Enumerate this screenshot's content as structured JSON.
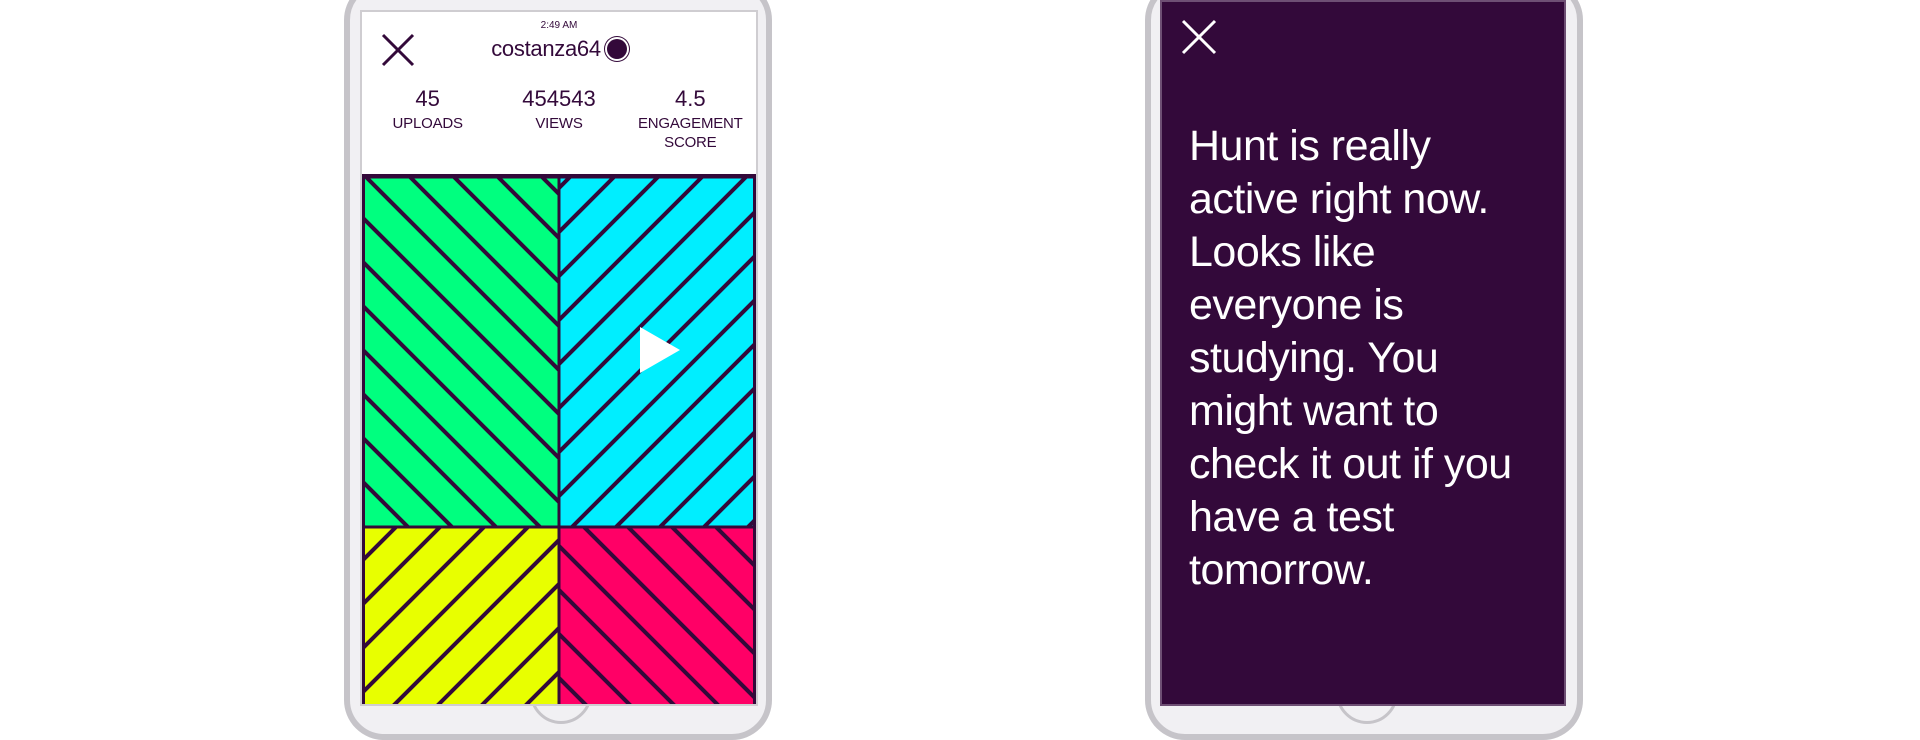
{
  "profile_screen": {
    "status_time": "2:49 AM",
    "username": "costanza64",
    "close_icon": "close-icon",
    "online_indicator_icon": "online-dot-icon",
    "stats": [
      {
        "value": "45",
        "label": "UPLOADS"
      },
      {
        "value": "454543",
        "label": "VIEWS"
      },
      {
        "value": "4.5",
        "label": "ENGAGEMENT SCORE"
      }
    ],
    "video": {
      "play_icon": "play-icon",
      "colors": {
        "top_left": "#00ff7f",
        "top_right": "#00eeff",
        "bottom_left": "#e8ff00",
        "bottom_right": "#ff0066",
        "stripe": "#33093a"
      }
    }
  },
  "message_screen": {
    "close_icon": "close-icon",
    "message": "Hunt is really active right now. Looks like everyone is studying. You might want to check it out if you have a test tomorrow."
  },
  "colors": {
    "brand_purple": "#33093a",
    "device_frame": "#c6c4c9"
  }
}
